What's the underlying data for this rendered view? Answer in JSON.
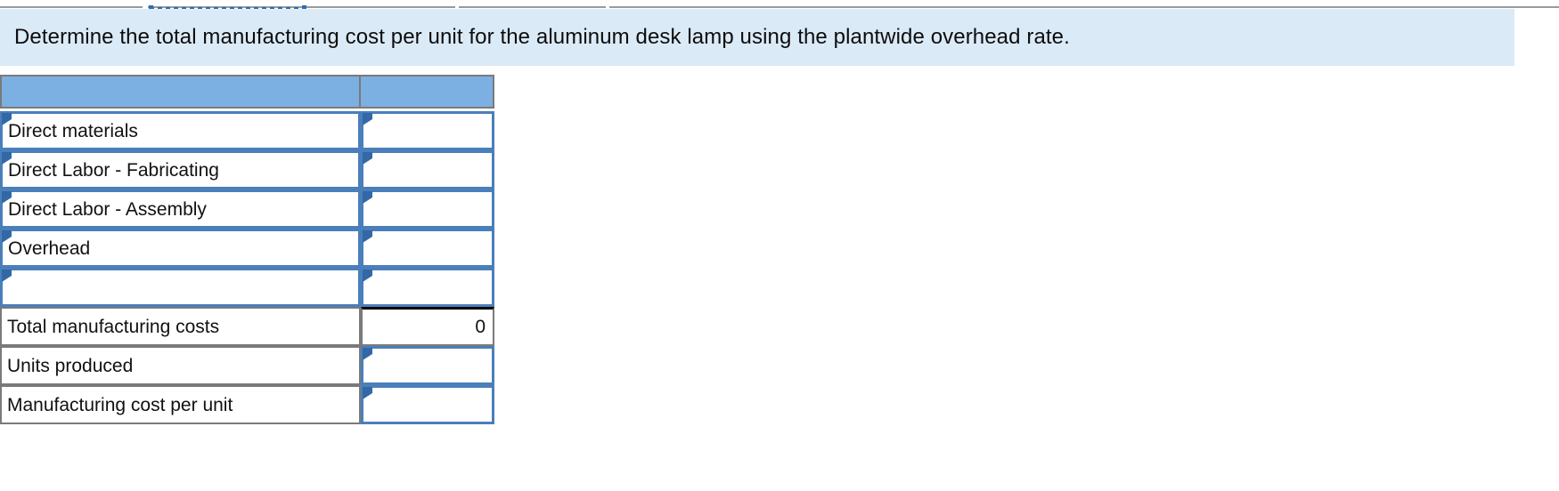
{
  "instruction": {
    "text": "Determine the total manufacturing cost per unit for the aluminum desk lamp using the plantwide overhead rate."
  },
  "colors": {
    "banner_background": "#dbeaf7",
    "table_header_blue": "#7cafe2",
    "input_border_blue": "#4a7fba",
    "input_marker_blue": "#3268a6",
    "plain_border_gray": "#7a7a7a",
    "total_rule_black": "#000000"
  },
  "worksheet": {
    "header": {
      "label_column": "",
      "value_column": ""
    },
    "rows": [
      {
        "label": "Direct materials",
        "value": "",
        "label_style": "input",
        "value_style": "input"
      },
      {
        "label": "Direct Labor - Fabricating",
        "value": "",
        "label_style": "input",
        "value_style": "input"
      },
      {
        "label": "Direct Labor - Assembly",
        "value": "",
        "label_style": "input",
        "value_style": "input"
      },
      {
        "label": "Overhead",
        "value": "",
        "label_style": "input",
        "value_style": "input"
      },
      {
        "label": "",
        "value": "",
        "label_style": "input",
        "value_style": "input"
      },
      {
        "label": "Total manufacturing costs",
        "value": "0",
        "label_style": "plain",
        "value_style": "plain-total"
      },
      {
        "label": "Units produced",
        "value": "",
        "label_style": "plain",
        "value_style": "input"
      },
      {
        "label": "Manufacturing cost per unit",
        "value": "",
        "label_style": "plain",
        "value_style": "input"
      }
    ]
  }
}
